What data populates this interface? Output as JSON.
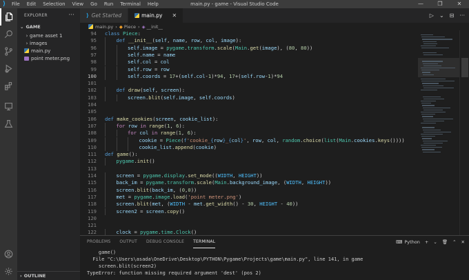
{
  "window": {
    "title": "main.py - game - Visual Studio Code",
    "menu": [
      "File",
      "Edit",
      "Selection",
      "View",
      "Go",
      "Run",
      "Terminal",
      "Help"
    ],
    "controls": [
      "—",
      "❐",
      "✕"
    ]
  },
  "activity_bar": {
    "top": [
      "files-icon",
      "search-icon",
      "source-control-icon",
      "run-debug-icon",
      "extensions-icon",
      "remote-explorer-icon",
      "testing-icon"
    ],
    "bottom": [
      "account-icon",
      "settings-gear-icon"
    ]
  },
  "sidebar": {
    "header": "EXPLORER",
    "more": "···",
    "section": "GAME",
    "items": [
      {
        "label": "game asset 1",
        "type": "folder",
        "chevron": "›"
      },
      {
        "label": "images",
        "type": "folder",
        "chevron": "›"
      },
      {
        "label": "main.py",
        "type": "python"
      },
      {
        "label": "point meter.png",
        "type": "image"
      }
    ],
    "outline": "OUTLINE"
  },
  "tabs": [
    {
      "label": "Get Started",
      "active": false
    },
    {
      "label": "main.py",
      "active": true,
      "close": "✕"
    }
  ],
  "tab_actions": [
    "▷",
    "⌄",
    "⊟",
    "···"
  ],
  "breadcrumb": [
    "main.py",
    "Piece",
    "__init__"
  ],
  "editor": {
    "current_line": 100,
    "lines": [
      {
        "n": 94,
        "indent": 0,
        "tokens": [
          [
            "k",
            "class"
          ],
          [
            "p",
            " "
          ],
          [
            "c",
            "Piece"
          ],
          [
            "p",
            ":"
          ]
        ]
      },
      {
        "n": 95,
        "indent": 1,
        "tokens": [
          [
            "k",
            "def"
          ],
          [
            "p",
            " "
          ],
          [
            "f",
            "__init__"
          ],
          [
            "p",
            "("
          ],
          [
            "v",
            "self"
          ],
          [
            "p",
            ", "
          ],
          [
            "v",
            "name"
          ],
          [
            "p",
            ", "
          ],
          [
            "v",
            "row"
          ],
          [
            "p",
            ", "
          ],
          [
            "v",
            "col"
          ],
          [
            "p",
            ", "
          ],
          [
            "v",
            "image"
          ],
          [
            "p",
            "):"
          ]
        ]
      },
      {
        "n": 96,
        "indent": 2,
        "tokens": [
          [
            "v",
            "self"
          ],
          [
            "p",
            "."
          ],
          [
            "v",
            "image"
          ],
          [
            "p",
            " = "
          ],
          [
            "c",
            "pygame"
          ],
          [
            "p",
            "."
          ],
          [
            "c",
            "transform"
          ],
          [
            "p",
            "."
          ],
          [
            "f",
            "scale"
          ],
          [
            "p",
            "("
          ],
          [
            "c",
            "Main"
          ],
          [
            "p",
            "."
          ],
          [
            "f",
            "get"
          ],
          [
            "p",
            "("
          ],
          [
            "v",
            "image"
          ],
          [
            "p",
            "), ("
          ],
          [
            "n",
            "80"
          ],
          [
            "p",
            ", "
          ],
          [
            "n",
            "80"
          ],
          [
            "p",
            "))"
          ]
        ]
      },
      {
        "n": 97,
        "indent": 2,
        "tokens": [
          [
            "v",
            "self"
          ],
          [
            "p",
            "."
          ],
          [
            "v",
            "name"
          ],
          [
            "p",
            " = "
          ],
          [
            "v",
            "name"
          ]
        ]
      },
      {
        "n": 98,
        "indent": 2,
        "tokens": [
          [
            "v",
            "self"
          ],
          [
            "p",
            "."
          ],
          [
            "v",
            "col"
          ],
          [
            "p",
            " = "
          ],
          [
            "v",
            "col"
          ]
        ]
      },
      {
        "n": 99,
        "indent": 2,
        "tokens": [
          [
            "v",
            "self"
          ],
          [
            "p",
            "."
          ],
          [
            "v",
            "row"
          ],
          [
            "p",
            " = "
          ],
          [
            "v",
            "row"
          ]
        ]
      },
      {
        "n": 100,
        "indent": 2,
        "tokens": [
          [
            "v",
            "self"
          ],
          [
            "p",
            "."
          ],
          [
            "v",
            "coords"
          ],
          [
            "p",
            " = "
          ],
          [
            "n",
            "17"
          ],
          [
            "p",
            "+("
          ],
          [
            "v",
            "self"
          ],
          [
            "p",
            "."
          ],
          [
            "v",
            "col"
          ],
          [
            "p",
            "-"
          ],
          [
            "n",
            "1"
          ],
          [
            "p",
            ")*"
          ],
          [
            "n",
            "94"
          ],
          [
            "p",
            ", "
          ],
          [
            "n",
            "17"
          ],
          [
            "p",
            "+("
          ],
          [
            "v",
            "self"
          ],
          [
            "p",
            "."
          ],
          [
            "v",
            "row"
          ],
          [
            "p",
            "-"
          ],
          [
            "n",
            "1"
          ],
          [
            "p",
            ")*"
          ],
          [
            "n",
            "94"
          ]
        ]
      },
      {
        "n": 101,
        "indent": 0,
        "tokens": []
      },
      {
        "n": 102,
        "indent": 1,
        "tokens": [
          [
            "k",
            "def"
          ],
          [
            "p",
            " "
          ],
          [
            "f",
            "draw"
          ],
          [
            "p",
            "("
          ],
          [
            "v",
            "self"
          ],
          [
            "p",
            ", "
          ],
          [
            "v",
            "screen"
          ],
          [
            "p",
            "):"
          ]
        ]
      },
      {
        "n": 103,
        "indent": 2,
        "tokens": [
          [
            "v",
            "screen"
          ],
          [
            "p",
            "."
          ],
          [
            "f",
            "blit"
          ],
          [
            "p",
            "("
          ],
          [
            "v",
            "self"
          ],
          [
            "p",
            "."
          ],
          [
            "v",
            "image"
          ],
          [
            "p",
            ", "
          ],
          [
            "v",
            "self"
          ],
          [
            "p",
            "."
          ],
          [
            "v",
            "coords"
          ],
          [
            "p",
            ")"
          ]
        ]
      },
      {
        "n": 104,
        "indent": 0,
        "tokens": []
      },
      {
        "n": 105,
        "indent": 0,
        "tokens": []
      },
      {
        "n": 106,
        "indent": 0,
        "tokens": [
          [
            "k",
            "def"
          ],
          [
            "p",
            " "
          ],
          [
            "f",
            "make_cookies"
          ],
          [
            "p",
            "("
          ],
          [
            "v",
            "screen"
          ],
          [
            "p",
            ", "
          ],
          [
            "v",
            "cookie_list"
          ],
          [
            "p",
            "):"
          ]
        ]
      },
      {
        "n": 107,
        "indent": 1,
        "tokens": [
          [
            "kc",
            "for"
          ],
          [
            "p",
            " "
          ],
          [
            "v",
            "row"
          ],
          [
            "p",
            " "
          ],
          [
            "kc",
            "in"
          ],
          [
            "p",
            " "
          ],
          [
            "f",
            "range"
          ],
          [
            "p",
            "("
          ],
          [
            "n",
            "1"
          ],
          [
            "p",
            ", "
          ],
          [
            "n",
            "6"
          ],
          [
            "p",
            "):"
          ]
        ]
      },
      {
        "n": 108,
        "indent": 2,
        "tokens": [
          [
            "kc",
            "for"
          ],
          [
            "p",
            " "
          ],
          [
            "v",
            "col"
          ],
          [
            "p",
            " "
          ],
          [
            "kc",
            "in"
          ],
          [
            "p",
            " "
          ],
          [
            "f",
            "range"
          ],
          [
            "p",
            "("
          ],
          [
            "n",
            "1"
          ],
          [
            "p",
            ", "
          ],
          [
            "n",
            "6"
          ],
          [
            "p",
            "):"
          ]
        ]
      },
      {
        "n": 109,
        "indent": 3,
        "tokens": [
          [
            "v",
            "cookie"
          ],
          [
            "p",
            " = "
          ],
          [
            "c",
            "Piece"
          ],
          [
            "p",
            "("
          ],
          [
            "sp",
            "f"
          ],
          [
            "s",
            "'cookie_"
          ],
          [
            "sp",
            "{"
          ],
          [
            "v",
            "row"
          ],
          [
            "sp",
            "}"
          ],
          [
            "s",
            "_"
          ],
          [
            "sp",
            "{"
          ],
          [
            "v",
            "col"
          ],
          [
            "sp",
            "}"
          ],
          [
            "s",
            "'"
          ],
          [
            "p",
            ", "
          ],
          [
            "v",
            "row"
          ],
          [
            "p",
            ", "
          ],
          [
            "v",
            "col"
          ],
          [
            "p",
            ", "
          ],
          [
            "c",
            "random"
          ],
          [
            "p",
            "."
          ],
          [
            "f",
            "choice"
          ],
          [
            "p",
            "("
          ],
          [
            "c",
            "list"
          ],
          [
            "p",
            "("
          ],
          [
            "c",
            "Main"
          ],
          [
            "p",
            "."
          ],
          [
            "v",
            "cookies"
          ],
          [
            "p",
            "."
          ],
          [
            "f",
            "keys"
          ],
          [
            "p",
            "())))"
          ]
        ]
      },
      {
        "n": 110,
        "indent": 3,
        "tokens": [
          [
            "v",
            "cookie_list"
          ],
          [
            "p",
            "."
          ],
          [
            "f",
            "append"
          ],
          [
            "p",
            "("
          ],
          [
            "v",
            "cookie"
          ],
          [
            "p",
            ")"
          ]
        ]
      },
      {
        "n": 111,
        "indent": 0,
        "tokens": [
          [
            "k",
            "def"
          ],
          [
            "p",
            " "
          ],
          [
            "f",
            "game"
          ],
          [
            "p",
            "():"
          ]
        ]
      },
      {
        "n": 112,
        "indent": 1,
        "tokens": [
          [
            "c",
            "pygame"
          ],
          [
            "p",
            "."
          ],
          [
            "f",
            "init"
          ],
          [
            "p",
            "()"
          ]
        ]
      },
      {
        "n": 113,
        "indent": 0,
        "tokens": []
      },
      {
        "n": 114,
        "indent": 1,
        "tokens": [
          [
            "v",
            "screen"
          ],
          [
            "p",
            " = "
          ],
          [
            "c",
            "pygame"
          ],
          [
            "p",
            "."
          ],
          [
            "c",
            "display"
          ],
          [
            "p",
            "."
          ],
          [
            "f",
            "set_mode"
          ],
          [
            "p",
            "(("
          ],
          [
            "cn",
            "WIDTH"
          ],
          [
            "p",
            ", "
          ],
          [
            "cn",
            "HEIGHT"
          ],
          [
            "p",
            "))"
          ]
        ]
      },
      {
        "n": 115,
        "indent": 1,
        "tokens": [
          [
            "v",
            "back_im"
          ],
          [
            "p",
            " = "
          ],
          [
            "c",
            "pygame"
          ],
          [
            "p",
            "."
          ],
          [
            "c",
            "transform"
          ],
          [
            "p",
            "."
          ],
          [
            "f",
            "scale"
          ],
          [
            "p",
            "("
          ],
          [
            "c",
            "Main"
          ],
          [
            "p",
            "."
          ],
          [
            "v",
            "background_image"
          ],
          [
            "p",
            ", ("
          ],
          [
            "cn",
            "WIDTH"
          ],
          [
            "p",
            ", "
          ],
          [
            "cn",
            "HEIGHT"
          ],
          [
            "p",
            "))"
          ]
        ]
      },
      {
        "n": 116,
        "indent": 1,
        "tokens": [
          [
            "v",
            "screen"
          ],
          [
            "p",
            "."
          ],
          [
            "f",
            "blit"
          ],
          [
            "p",
            "("
          ],
          [
            "v",
            "back_im"
          ],
          [
            "p",
            ", ("
          ],
          [
            "n",
            "0"
          ],
          [
            "p",
            ","
          ],
          [
            "n",
            "0"
          ],
          [
            "p",
            "))"
          ]
        ]
      },
      {
        "n": 117,
        "indent": 1,
        "tokens": [
          [
            "v",
            "met"
          ],
          [
            "p",
            " = "
          ],
          [
            "c",
            "pygame"
          ],
          [
            "p",
            "."
          ],
          [
            "c",
            "image"
          ],
          [
            "p",
            "."
          ],
          [
            "f",
            "load"
          ],
          [
            "p",
            "("
          ],
          [
            "s",
            "'point meter.png'"
          ],
          [
            "p",
            ")"
          ]
        ]
      },
      {
        "n": 118,
        "indent": 1,
        "tokens": [
          [
            "v",
            "screen"
          ],
          [
            "p",
            "."
          ],
          [
            "f",
            "blit"
          ],
          [
            "p",
            "("
          ],
          [
            "v",
            "met"
          ],
          [
            "p",
            ", ("
          ],
          [
            "cn",
            "WIDTH"
          ],
          [
            "p",
            " - "
          ],
          [
            "v",
            "met"
          ],
          [
            "p",
            "."
          ],
          [
            "f",
            "get_width"
          ],
          [
            "p",
            "() - "
          ],
          [
            "n",
            "30"
          ],
          [
            "p",
            ", "
          ],
          [
            "cn",
            "HEIGHT"
          ],
          [
            "p",
            " - "
          ],
          [
            "n",
            "40"
          ],
          [
            "p",
            "))"
          ]
        ]
      },
      {
        "n": 119,
        "indent": 1,
        "tokens": [
          [
            "v",
            "screen2"
          ],
          [
            "p",
            " = "
          ],
          [
            "v",
            "screen"
          ],
          [
            "p",
            "."
          ],
          [
            "f",
            "copy"
          ],
          [
            "p",
            "()"
          ]
        ]
      },
      {
        "n": 120,
        "indent": 0,
        "tokens": []
      },
      {
        "n": 121,
        "indent": 0,
        "tokens": []
      },
      {
        "n": 122,
        "indent": 1,
        "tokens": [
          [
            "v",
            "clock"
          ],
          [
            "p",
            " = "
          ],
          [
            "c",
            "pygame"
          ],
          [
            "p",
            "."
          ],
          [
            "c",
            "time"
          ],
          [
            "p",
            "."
          ],
          [
            "c",
            "Clock"
          ],
          [
            "p",
            "()"
          ]
        ]
      }
    ]
  },
  "panel": {
    "tabs": [
      "PROBLEMS",
      "OUTPUT",
      "DEBUG CONSOLE",
      "TERMINAL"
    ],
    "active_tab": "TERMINAL",
    "shell": "Python",
    "actions": [
      "+",
      "⌄",
      "🗑",
      "⌃",
      "✕"
    ],
    "terminal_lines": [
      "    game()",
      "  File \"C:\\Users\\asada\\OneDrive\\Desktop\\PYTHON\\Pygame\\Projects\\game\\main.py\", line 141, in game",
      "    screen.blit(screen2)",
      "TypeError: function missing required argument 'dest' (pos 2)"
    ]
  }
}
